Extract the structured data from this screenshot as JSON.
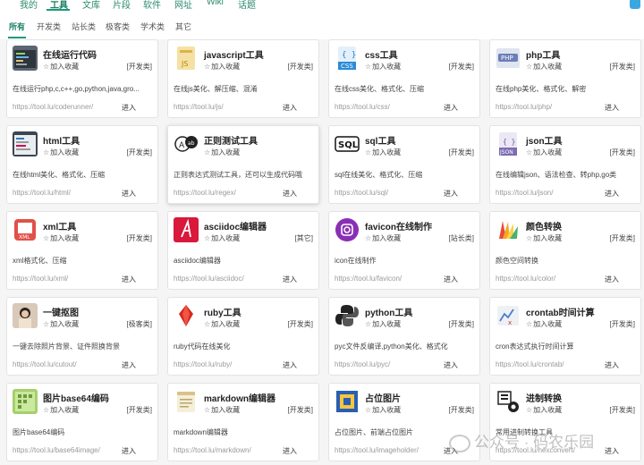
{
  "topnav": {
    "items": [
      "我的",
      "工具",
      "文库",
      "片段",
      "软件",
      "网址",
      "Wiki",
      "话题"
    ],
    "active_index": 1
  },
  "subtabs": {
    "items": [
      "所有",
      "开发类",
      "站长类",
      "极客类",
      "学术类",
      "其它"
    ],
    "active_index": 0
  },
  "fav_label": "加入收藏",
  "enter_label": "进入",
  "cards": [
    {
      "title": "在线运行代码",
      "category": "[开发类]",
      "desc": "在线运行php,c,c++,go,python,java,gro...",
      "url": "https://tool.lu/coderunner/",
      "icon": "code-editor-icon"
    },
    {
      "title": "javascript工具",
      "category": "[开发类]",
      "desc": "在线js美化、解压缩、混淆",
      "url": "https://tool.lu/js/",
      "icon": "js-file-icon"
    },
    {
      "title": "css工具",
      "category": "[开发类]",
      "desc": "在线css美化、格式化、压缩",
      "url": "https://tool.lu/css/",
      "icon": "css-file-icon"
    },
    {
      "title": "php工具",
      "category": "[开发类]",
      "desc": "在线php美化、格式化、解密",
      "url": "https://tool.lu/php/",
      "icon": "php-icon"
    },
    {
      "title": "html工具",
      "category": "[开发类]",
      "desc": "在线html美化、格式化、压缩",
      "url": "https://tool.lu/html/",
      "icon": "html-editor-icon"
    },
    {
      "title": "正则测试工具",
      "category": "",
      "desc": "正则表达式测试工具，还可以生成代码哦",
      "url": "https://tool.lu/regex/",
      "icon": "regex-icon"
    },
    {
      "title": "sql工具",
      "category": "[开发类]",
      "desc": "sql在线美化、格式化、压缩",
      "url": "https://tool.lu/sql/",
      "icon": "sql-icon"
    },
    {
      "title": "json工具",
      "category": "[开发类]",
      "desc": "在线编辑json、语法检查、转php,go类",
      "url": "https://tool.lu/json/",
      "icon": "json-file-icon"
    },
    {
      "title": "xml工具",
      "category": "[开发类]",
      "desc": "xml格式化、压缩",
      "url": "https://tool.lu/xml/",
      "icon": "xml-file-icon"
    },
    {
      "title": "asciidoc编辑器",
      "category": "[其它]",
      "desc": "asciidoc编辑器",
      "url": "https://tool.lu/asciidoc/",
      "icon": "asciidoc-icon"
    },
    {
      "title": "favicon在线制作",
      "category": "[站长类]",
      "desc": "icon在线制作",
      "url": "https://tool.lu/favicon/",
      "icon": "favicon-icon"
    },
    {
      "title": "颜色转换",
      "category": "[开发类]",
      "desc": "颜色空间转换",
      "url": "https://tool.lu/color/",
      "icon": "color-palette-icon"
    },
    {
      "title": "一键抠图",
      "category": "[极客类]",
      "desc": "一键去除照片背景、证件照换背景",
      "url": "https://tool.lu/cutout/",
      "icon": "portrait-icon"
    },
    {
      "title": "ruby工具",
      "category": "[开发类]",
      "desc": "ruby代码在线美化",
      "url": "https://tool.lu/ruby/",
      "icon": "ruby-gem-icon"
    },
    {
      "title": "python工具",
      "category": "[开发类]",
      "desc": "pyc文件反编译,python美化、格式化",
      "url": "https://tool.lu/pyc/",
      "icon": "python-icon"
    },
    {
      "title": "crontab时间计算",
      "category": "[开发类]",
      "desc": "cron表达式执行时间计算",
      "url": "https://tool.lu/crontab/",
      "icon": "crontab-icon"
    },
    {
      "title": "图片base64编码",
      "category": "[开发类]",
      "desc": "图片base64编码",
      "url": "https://tool.lu/base64image/",
      "icon": "image-base64-icon"
    },
    {
      "title": "markdown编辑器",
      "category": "[开发类]",
      "desc": "markdown编辑器",
      "url": "https://tool.lu/markdown/",
      "icon": "notepad-icon"
    },
    {
      "title": "占位图片",
      "category": "[开发类]",
      "desc": "占位图片、前端占位图片",
      "url": "https://tool.lu/imageholder/",
      "icon": "placeholder-image-icon"
    },
    {
      "title": "进制转换",
      "category": "[开发类]",
      "desc": "常用进制转换工具",
      "url": "https://tool.lu/hexconvert/",
      "icon": "binary-convert-icon"
    }
  ],
  "watermark": "公众号 · 码农乐园"
}
